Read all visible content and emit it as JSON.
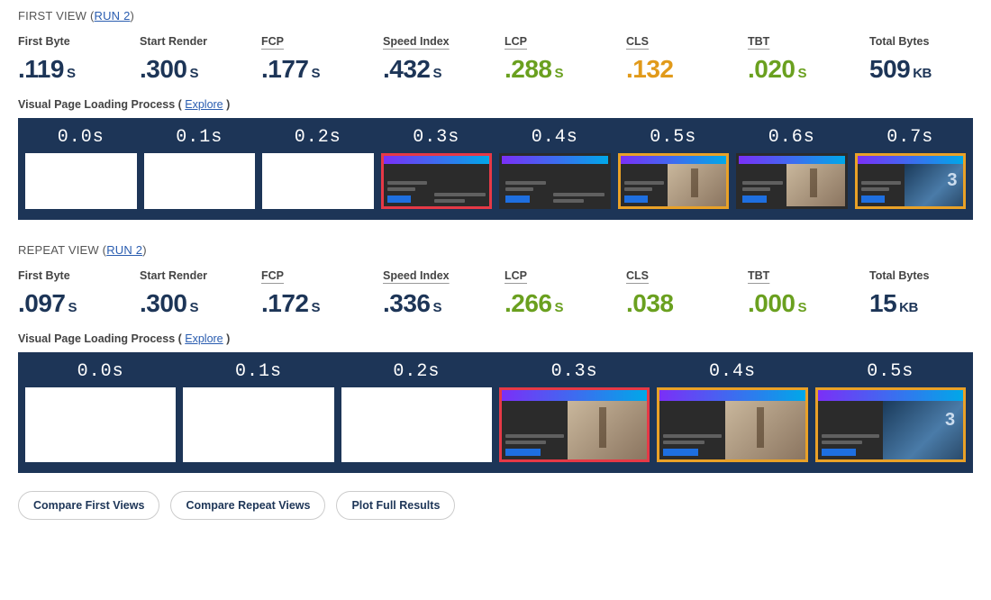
{
  "first_view": {
    "title_prefix": "FIRST VIEW (",
    "run_link": "RUN 2",
    "title_suffix": ")",
    "metrics": [
      {
        "label": "First Byte",
        "value": ".119",
        "unit": "S",
        "color": "dark",
        "underline": false
      },
      {
        "label": "Start Render",
        "value": ".300",
        "unit": "S",
        "color": "dark",
        "underline": false
      },
      {
        "label": "FCP",
        "value": ".177",
        "unit": "S",
        "color": "dark",
        "underline": true
      },
      {
        "label": "Speed Index",
        "value": ".432",
        "unit": "S",
        "color": "dark",
        "underline": true
      },
      {
        "label": "LCP",
        "value": ".288",
        "unit": "S",
        "color": "green",
        "underline": true
      },
      {
        "label": "CLS",
        "value": ".132",
        "unit": "",
        "color": "orange",
        "underline": true
      },
      {
        "label": "TBT",
        "value": ".020",
        "unit": "S",
        "color": "green",
        "underline": true
      },
      {
        "label": "Total Bytes",
        "value": "509",
        "unit": "KB",
        "color": "dark",
        "underline": false
      }
    ],
    "vpl_label": "Visual Page Loading Process",
    "vpl_link": "Explore",
    "frames": [
      {
        "time": "0.0s",
        "state": "white",
        "border": ""
      },
      {
        "time": "0.1s",
        "state": "white",
        "border": ""
      },
      {
        "time": "0.2s",
        "state": "white",
        "border": ""
      },
      {
        "time": "0.3s",
        "state": "dark-no-image",
        "border": "red"
      },
      {
        "time": "0.4s",
        "state": "dark-no-image",
        "border": ""
      },
      {
        "time": "0.5s",
        "state": "dark-image1",
        "border": "orange"
      },
      {
        "time": "0.6s",
        "state": "dark-image1",
        "border": ""
      },
      {
        "time": "0.7s",
        "state": "dark-image2",
        "border": "orange"
      }
    ]
  },
  "repeat_view": {
    "title_prefix": "REPEAT VIEW (",
    "run_link": "RUN 2",
    "title_suffix": ")",
    "metrics": [
      {
        "label": "First Byte",
        "value": ".097",
        "unit": "S",
        "color": "dark",
        "underline": false
      },
      {
        "label": "Start Render",
        "value": ".300",
        "unit": "S",
        "color": "dark",
        "underline": false
      },
      {
        "label": "FCP",
        "value": ".172",
        "unit": "S",
        "color": "dark",
        "underline": true
      },
      {
        "label": "Speed Index",
        "value": ".336",
        "unit": "S",
        "color": "dark",
        "underline": true
      },
      {
        "label": "LCP",
        "value": ".266",
        "unit": "S",
        "color": "green",
        "underline": true
      },
      {
        "label": "CLS",
        "value": ".038",
        "unit": "",
        "color": "green",
        "underline": true
      },
      {
        "label": "TBT",
        "value": ".000",
        "unit": "S",
        "color": "green",
        "underline": true
      },
      {
        "label": "Total Bytes",
        "value": "15",
        "unit": "KB",
        "color": "dark",
        "underline": false
      }
    ],
    "vpl_label": "Visual Page Loading Process",
    "vpl_link": "Explore",
    "frames": [
      {
        "time": "0.0s",
        "state": "white",
        "border": ""
      },
      {
        "time": "0.1s",
        "state": "white",
        "border": ""
      },
      {
        "time": "0.2s",
        "state": "white",
        "border": ""
      },
      {
        "time": "0.3s",
        "state": "dark-image1",
        "border": "red"
      },
      {
        "time": "0.4s",
        "state": "dark-image1",
        "border": "orange"
      },
      {
        "time": "0.5s",
        "state": "dark-image2",
        "border": "orange"
      }
    ]
  },
  "buttons": {
    "compare_first": "Compare First Views",
    "compare_repeat": "Compare Repeat Views",
    "plot_full": "Plot Full Results"
  }
}
